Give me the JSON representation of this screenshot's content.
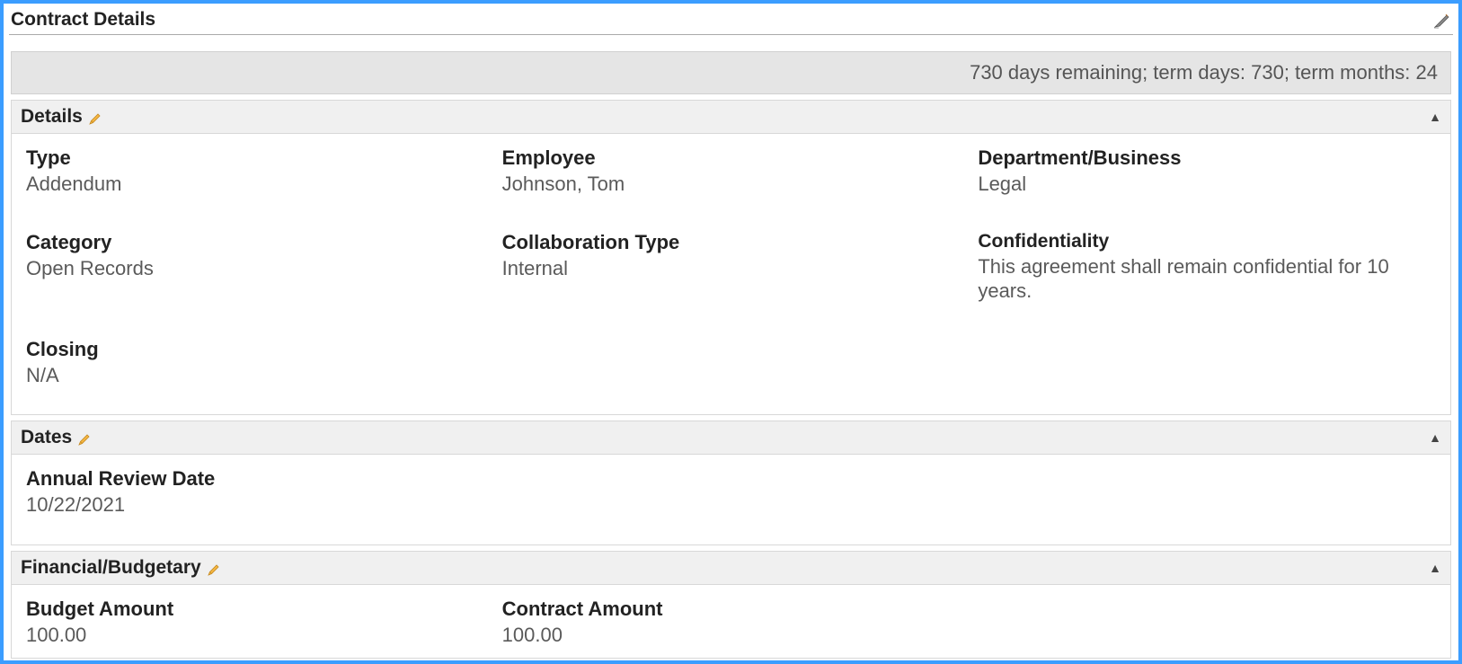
{
  "header": {
    "title": "Contract Details"
  },
  "status_bar": {
    "text": "730 days remaining; term days: 730; term months: 24"
  },
  "sections": {
    "details": {
      "title": "Details",
      "fields": {
        "type": {
          "label": "Type",
          "value": "Addendum"
        },
        "employee": {
          "label": "Employee",
          "value": "Johnson, Tom"
        },
        "department": {
          "label": "Department/Business",
          "value": "Legal"
        },
        "category": {
          "label": "Category",
          "value": "Open Records"
        },
        "collaboration_type": {
          "label": "Collaboration Type",
          "value": "Internal"
        },
        "confidentiality": {
          "label": "Confidentiality",
          "value": "This agreement shall remain confidential for 10 years."
        },
        "closing": {
          "label": "Closing",
          "value": "N/A"
        }
      }
    },
    "dates": {
      "title": "Dates",
      "fields": {
        "annual_review_date": {
          "label": "Annual Review Date",
          "value": "10/22/2021"
        }
      }
    },
    "financial": {
      "title": "Financial/Budgetary",
      "fields": {
        "budget_amount": {
          "label": "Budget Amount",
          "value": "100.00"
        },
        "contract_amount": {
          "label": "Contract Amount",
          "value": "100.00"
        }
      }
    }
  }
}
